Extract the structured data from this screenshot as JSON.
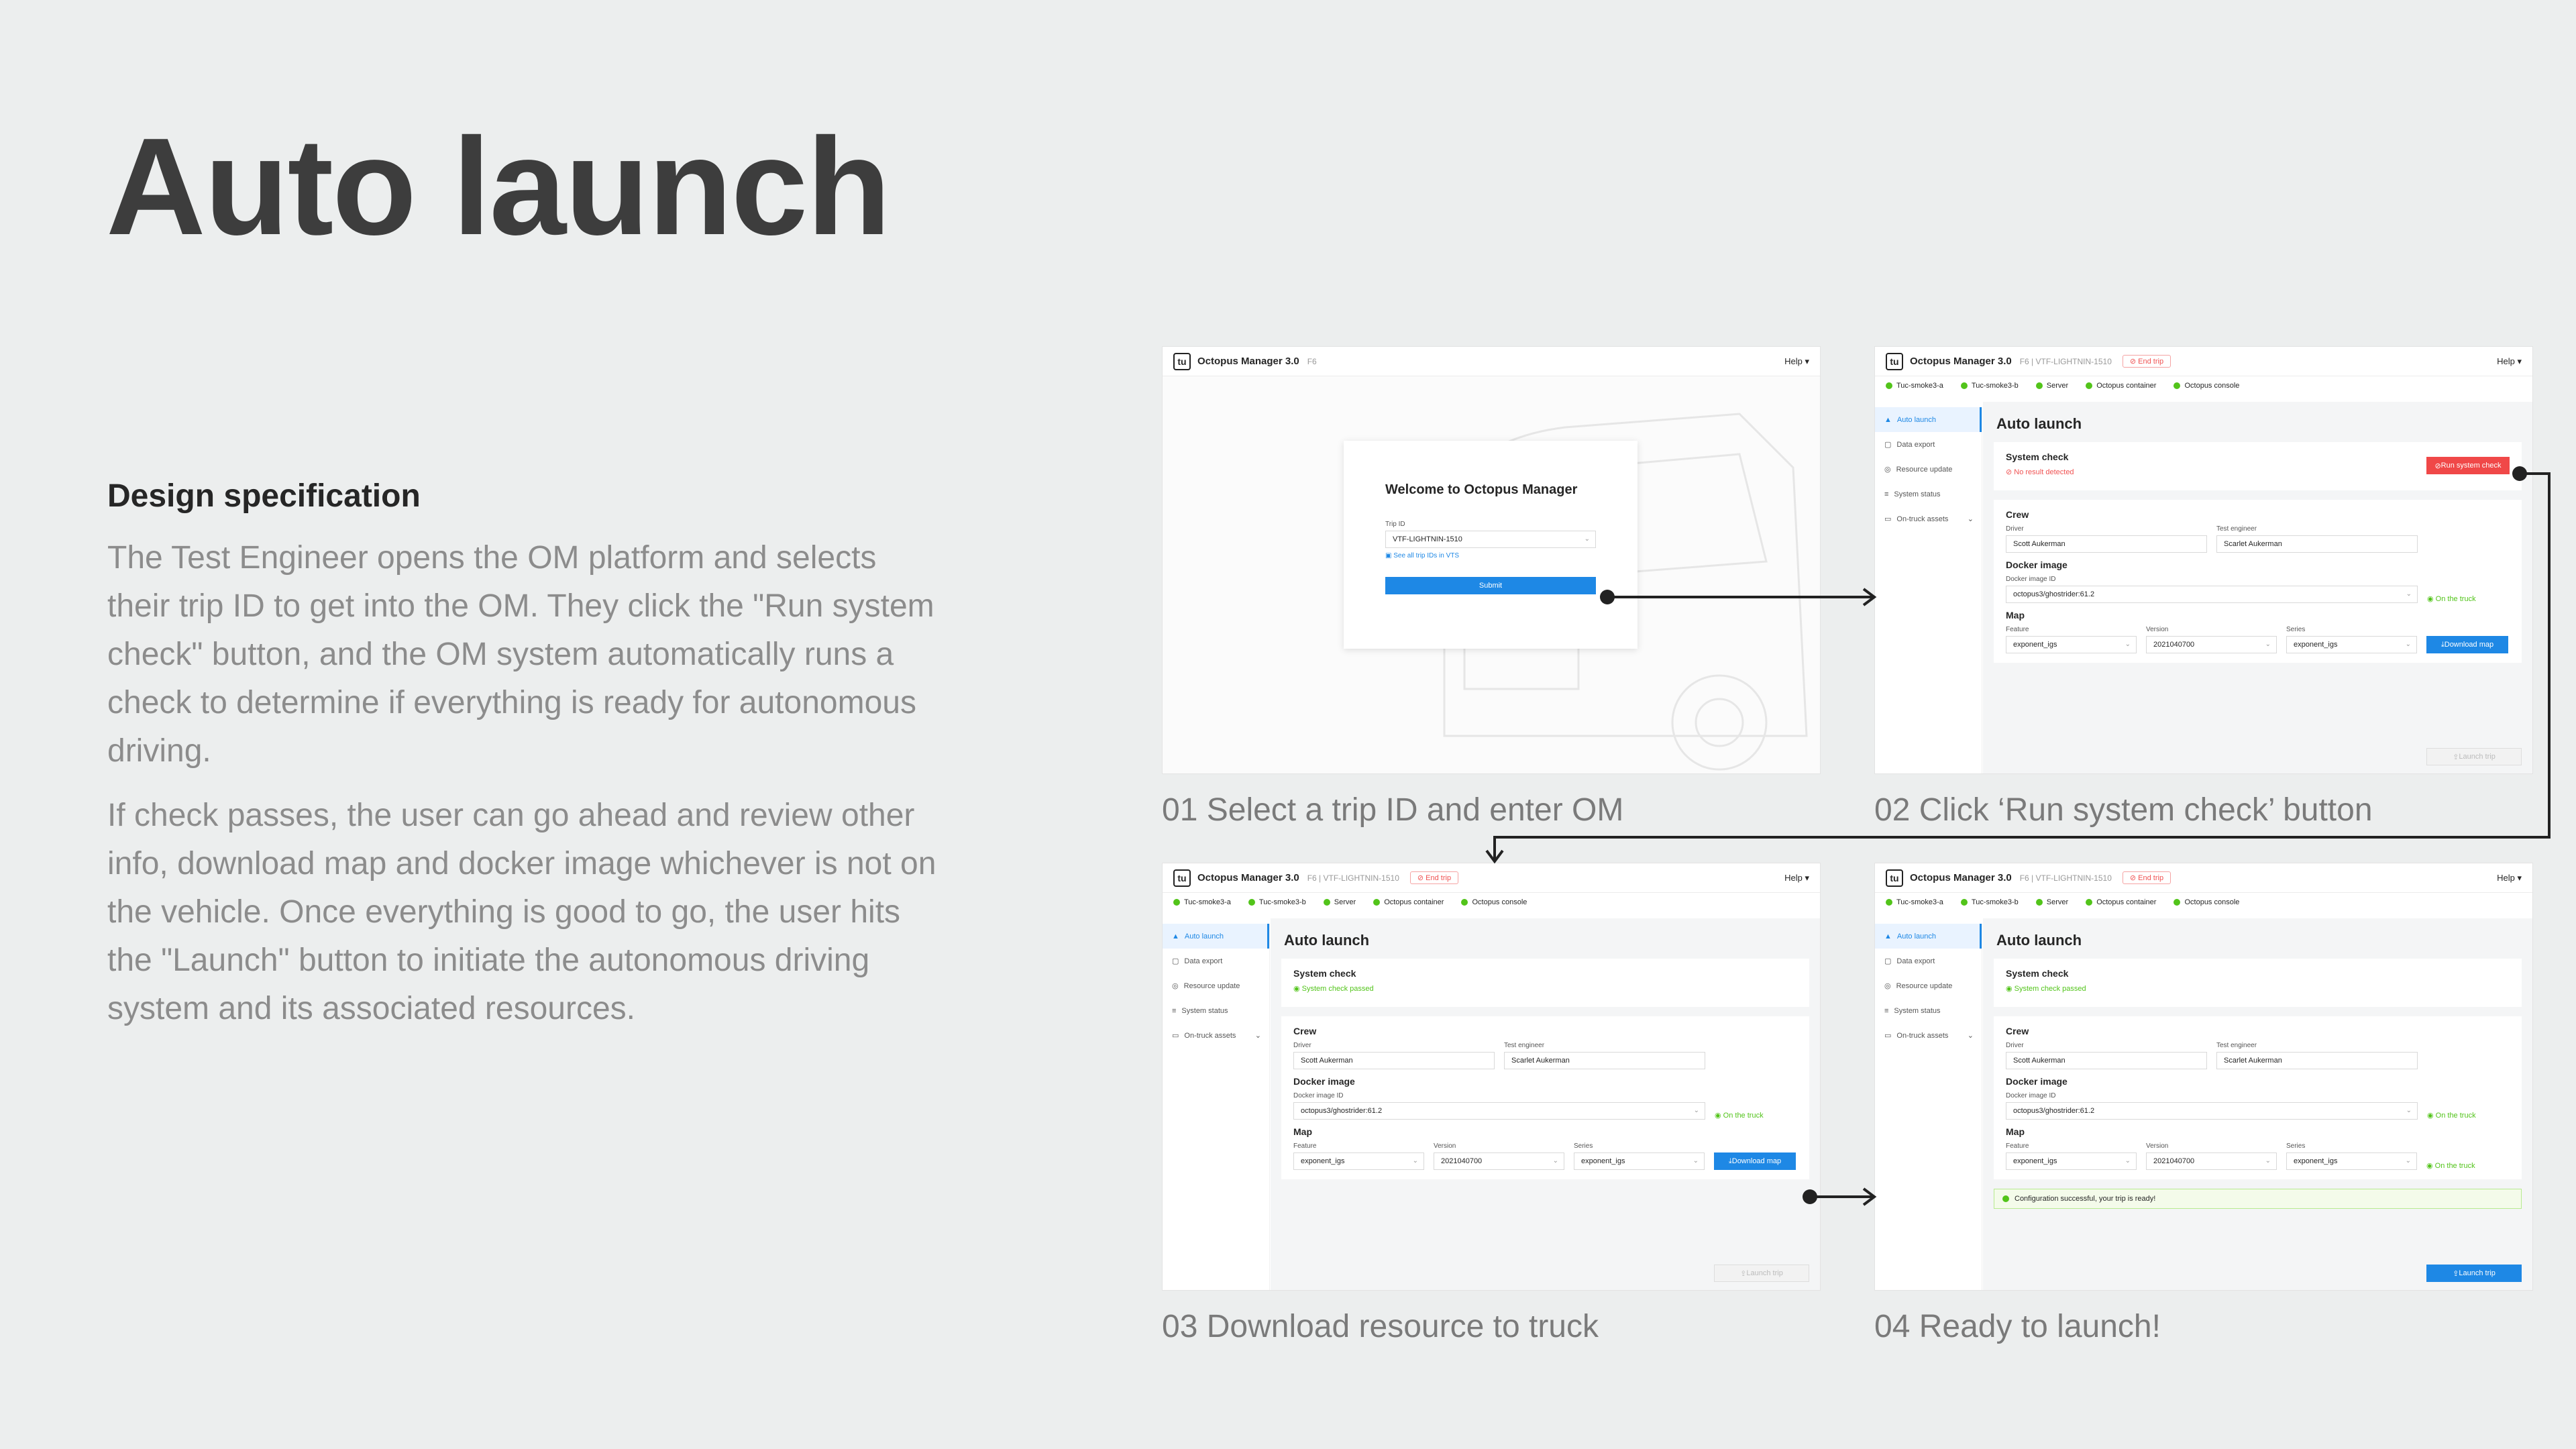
{
  "title": "Auto launch",
  "spec": {
    "heading": "Design specification",
    "para1": "The Test Engineer opens the OM platform and selects their trip ID to get into the OM. They click the \"Run system check\" button, and the OM system automatically runs a check to determine if everything is ready for autonomous driving.",
    "para2": "If check passes, the user can go ahead and review other info, download map and docker image whichever is not on the vehicle. Once everything is good to go, the user hits the \"Launch\" button to initiate the autonomous driving system and its associated resources."
  },
  "captions": {
    "c1": "01 Select a trip ID and enter OM",
    "c2": "02 Click ‘Run system check’ button",
    "c3": "03 Download resource to truck",
    "c4": "04 Ready to launch!"
  },
  "app": {
    "logo": "tu",
    "name": "Octopus Manager 3.0",
    "sub_login": "F6",
    "sub": "F6 | VTF-LIGHTNIN-1510",
    "end_trip": "End trip",
    "help": "Help ▾",
    "status": [
      "Tuc-smoke3-a",
      "Tuc-smoke3-b",
      "Server",
      "Octopus container",
      "Octopus console"
    ],
    "nav": [
      "Auto launch",
      "Data export",
      "Resource update",
      "System status",
      "On-truck assets"
    ],
    "page_title": "Auto launch"
  },
  "login": {
    "welcome": "Welcome to Octopus Manager",
    "trip_label": "Trip ID",
    "trip_value": "VTF-LIGHTNIN-1510",
    "link": "See all trip IDs in VTS",
    "submit": "Submit"
  },
  "check": {
    "title": "System check",
    "fail": "No result detected",
    "pass": "System check passed",
    "run": "Run system check"
  },
  "crew": {
    "title": "Crew",
    "driver_label": "Driver",
    "driver": "Scott Aukerman",
    "eng_label": "Test engineer",
    "eng": "Scarlet Aukerman"
  },
  "docker": {
    "title": "Docker image",
    "label": "Docker image ID",
    "value": "octopus3/ghostrider:61.2",
    "status": "On the truck"
  },
  "map": {
    "title": "Map",
    "feature_label": "Feature",
    "feature": "exponent_igs",
    "version_label": "Version",
    "version": "2021040700",
    "series_label": "Series",
    "series": "exponent_igs",
    "download": "Download map",
    "status": "On the truck"
  },
  "success": "Configuration successful, your trip is ready!",
  "launch": "Launch trip",
  "colors": {
    "accent": "#1e88e5",
    "danger": "#f04848",
    "success": "#52c41a"
  }
}
